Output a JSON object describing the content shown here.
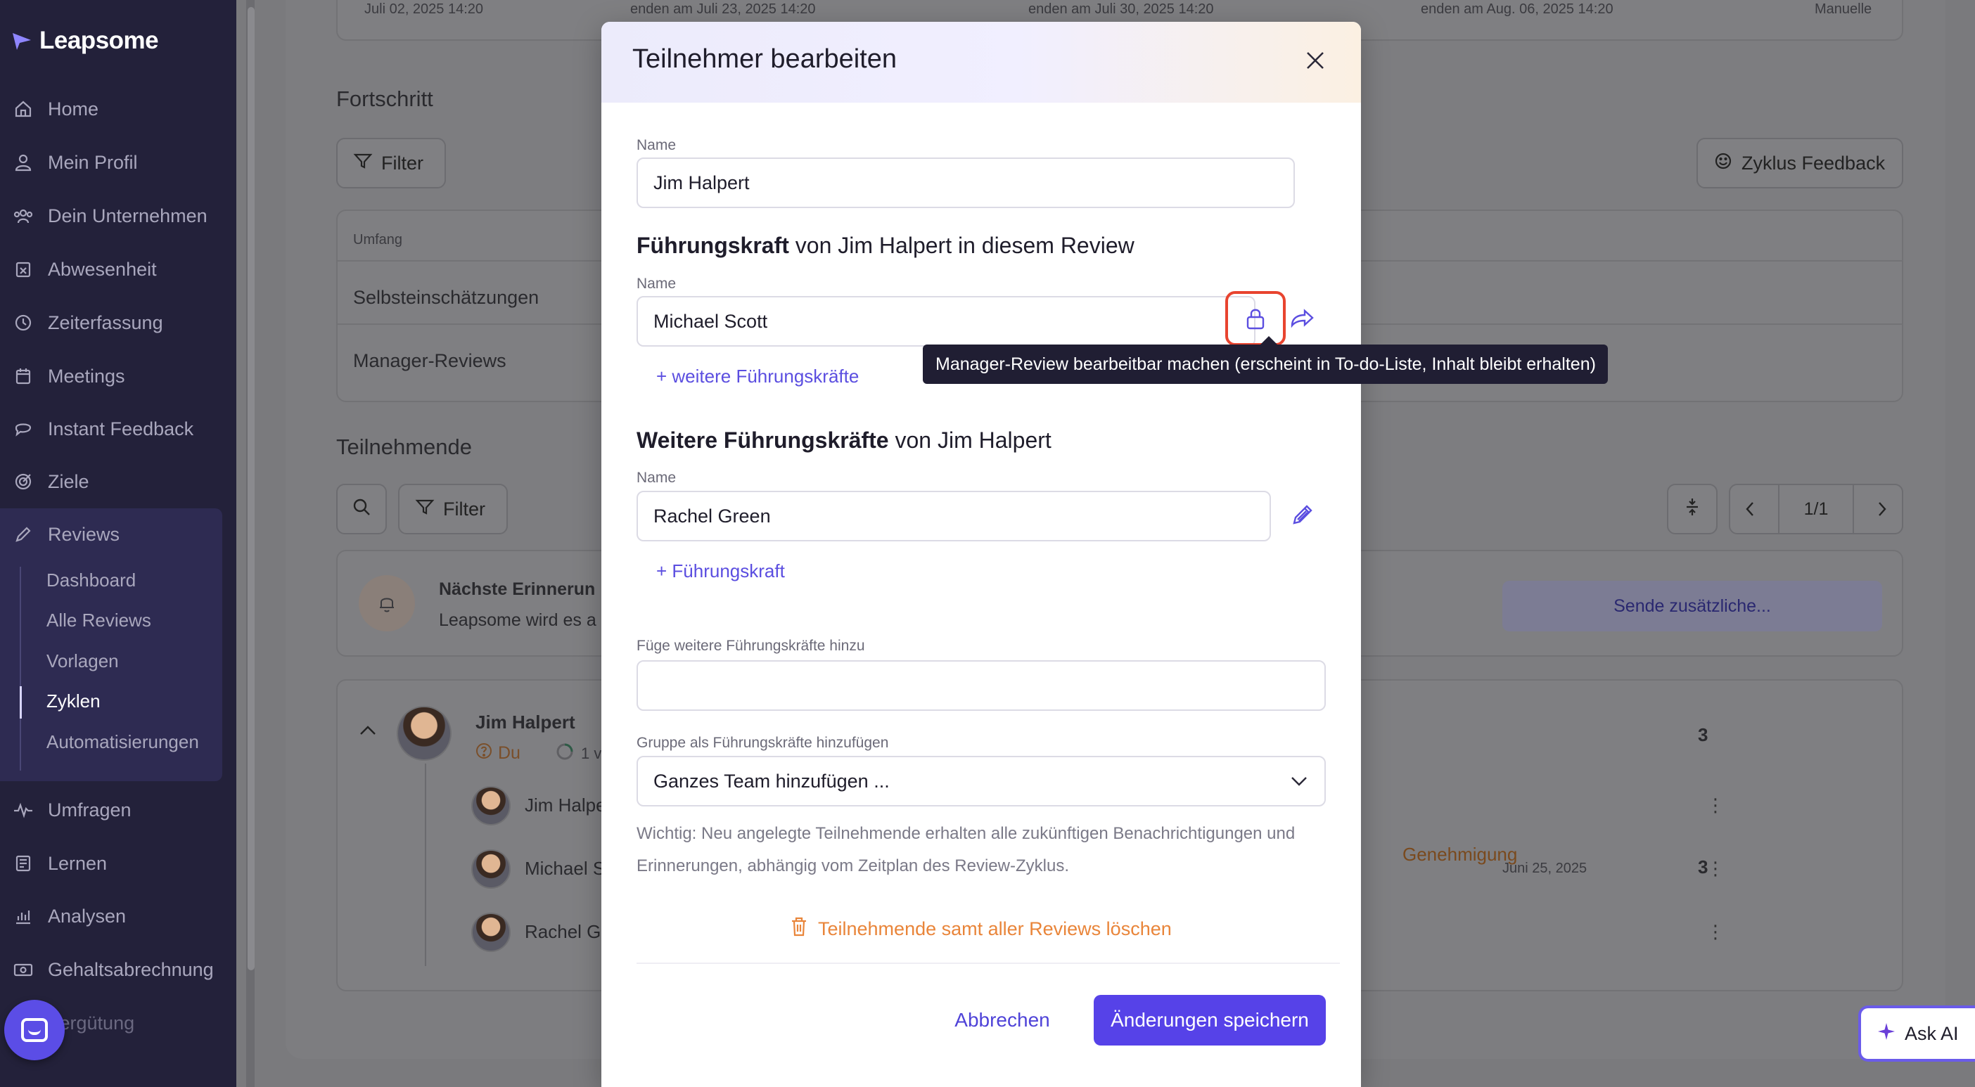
{
  "app": {
    "brand": "Leapsome"
  },
  "sidebar": {
    "items": [
      {
        "label": "Home",
        "icon": "home-icon"
      },
      {
        "label": "Mein Profil",
        "icon": "user-icon"
      },
      {
        "label": "Dein Unternehmen",
        "icon": "users-icon"
      },
      {
        "label": "Abwesenheit",
        "icon": "calendar-x-icon"
      },
      {
        "label": "Zeiterfassung",
        "icon": "clock-icon"
      },
      {
        "label": "Meetings",
        "icon": "calendar-icon"
      },
      {
        "label": "Instant Feedback",
        "icon": "chat-icon"
      },
      {
        "label": "Ziele",
        "icon": "target-icon"
      },
      {
        "label": "Reviews",
        "icon": "pencil-icon"
      },
      {
        "label": "Umfragen",
        "icon": "pulse-icon"
      },
      {
        "label": "Lernen",
        "icon": "book-icon"
      },
      {
        "label": "Analysen",
        "icon": "chart-icon"
      },
      {
        "label": "Gehaltsabrechnung",
        "icon": "money-icon"
      },
      {
        "label": "Vergütung",
        "icon": "coins-icon"
      }
    ],
    "reviews_sub": [
      "Dashboard",
      "Alle Reviews",
      "Vorlagen",
      "Zyklen",
      "Automatisierungen"
    ],
    "active_sub": "Zyklen"
  },
  "background": {
    "timeline": [
      "Juli 02, 2025 14:20",
      "enden am Juli 23, 2025 14:20",
      "enden am Juli 30, 2025 14:20",
      "enden am Aug. 06, 2025 14:20",
      "Manuelle"
    ],
    "progress_title": "Fortschritt",
    "filter_label": "Filter",
    "cycle_feedback": "Zyklus Feedback",
    "table_header": "Umfang",
    "table_rows": [
      "Selbsteinschätzungen",
      "Manager-Reviews"
    ],
    "participants_title": "Teilnehmende",
    "pagination": "1/1",
    "reminder_title": "Nächste Erinnerun",
    "reminder_text": "Leapsome wird es a",
    "send_more": "Sende zusätzliche...",
    "participant_name": "Jim Halpert",
    "participant_role": "Du",
    "participant_count": "3",
    "participant_progress": "1 v",
    "sub_rows": [
      {
        "name": "Jim Halpe",
        "date": "",
        "count": ""
      },
      {
        "name": "Michael S",
        "status": "Genehmigung",
        "date": "Juni 25, 2025",
        "count": "3"
      },
      {
        "name": "Rachel Gr",
        "date": "",
        "count": ""
      }
    ]
  },
  "modal": {
    "title": "Teilnehmer bearbeiten",
    "name_label": "Name",
    "name_value": "Jim Halpert",
    "manager_section_bold": "Führungskraft",
    "manager_section_rest": " von Jim Halpert in diesem Review",
    "manager_label": "Name",
    "manager_value": "Michael Scott",
    "add_more_managers": "+ weitere Führungskräfte",
    "further_section_bold": "Weitere Führungskräfte",
    "further_section_rest": " von Jim Halpert",
    "further_label": "Name",
    "further_value": "Rachel Green",
    "add_manager": "+ Führungskraft",
    "add_more_label": "Füge weitere Führungskräfte hinzu",
    "add_more_value": "",
    "group_label": "Gruppe als Führungskräfte hinzufügen",
    "group_select": "Ganzes Team hinzufügen ...",
    "hint": "Wichtig: Neu angelegte Teilnehmende erhalten alle zukünftigen Benachrichtigungen und Erinnerungen, abhängig vom Zeitplan des Review-Zyklus.",
    "delete_label": "Teilnehmende samt aller Reviews löschen",
    "cancel_label": "Abbrechen",
    "save_label": "Änderungen speichern"
  },
  "tooltip": {
    "text": "Manager-Review bearbeitbar machen (erscheint in To-do-Liste, Inhalt bleibt erhalten)"
  },
  "ask_ai": {
    "label": "Ask AI"
  },
  "colors": {
    "accent": "#5642e8",
    "danger": "#e8442f",
    "warning": "#e9853a",
    "sidebar": "#23213a"
  }
}
